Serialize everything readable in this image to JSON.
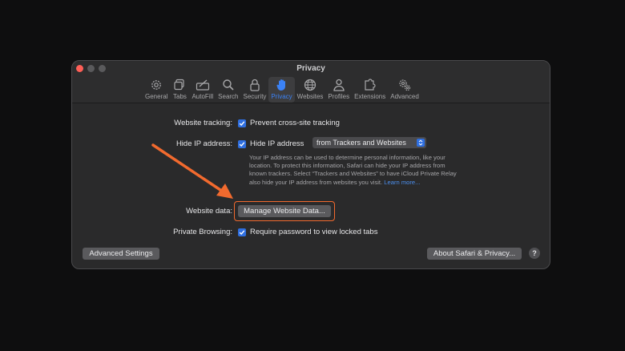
{
  "window": {
    "title": "Privacy"
  },
  "toolbar": {
    "items": [
      {
        "label": "General",
        "icon": "gear-icon"
      },
      {
        "label": "Tabs",
        "icon": "tabs-icon"
      },
      {
        "label": "AutoFill",
        "icon": "autofill-icon"
      },
      {
        "label": "Search",
        "icon": "search-icon"
      },
      {
        "label": "Security",
        "icon": "lock-icon"
      },
      {
        "label": "Privacy",
        "icon": "hand-icon",
        "active": true
      },
      {
        "label": "Websites",
        "icon": "globe-icon"
      },
      {
        "label": "Profiles",
        "icon": "person-icon"
      },
      {
        "label": "Extensions",
        "icon": "puzzle-icon"
      },
      {
        "label": "Advanced",
        "icon": "gears-icon"
      }
    ]
  },
  "settings": {
    "tracking_label": "Website tracking:",
    "tracking_option": "Prevent cross-site tracking",
    "hide_ip_label": "Hide IP address:",
    "hide_ip_option": "Hide IP address",
    "hide_ip_select": "from Trackers and Websites",
    "hide_ip_desc": "Your IP address can be used to determine personal information, like your location. To protect this information, Safari can hide your IP address from known trackers. Select “Trackers and Websites” to have iCloud Private Relay also hide your IP address from websites you visit.",
    "learn_more": "Learn more...",
    "website_data_label": "Website data:",
    "manage_button": "Manage Website Data...",
    "private_label": "Private Browsing:",
    "private_option": "Require password to view locked tabs"
  },
  "footer": {
    "advanced_button": "Advanced Settings",
    "about_button": "About Safari & Privacy...",
    "help": "?"
  },
  "colors": {
    "accent": "#2f6fe0",
    "annotation": "#f26a2e",
    "close": "#ff5f57"
  }
}
